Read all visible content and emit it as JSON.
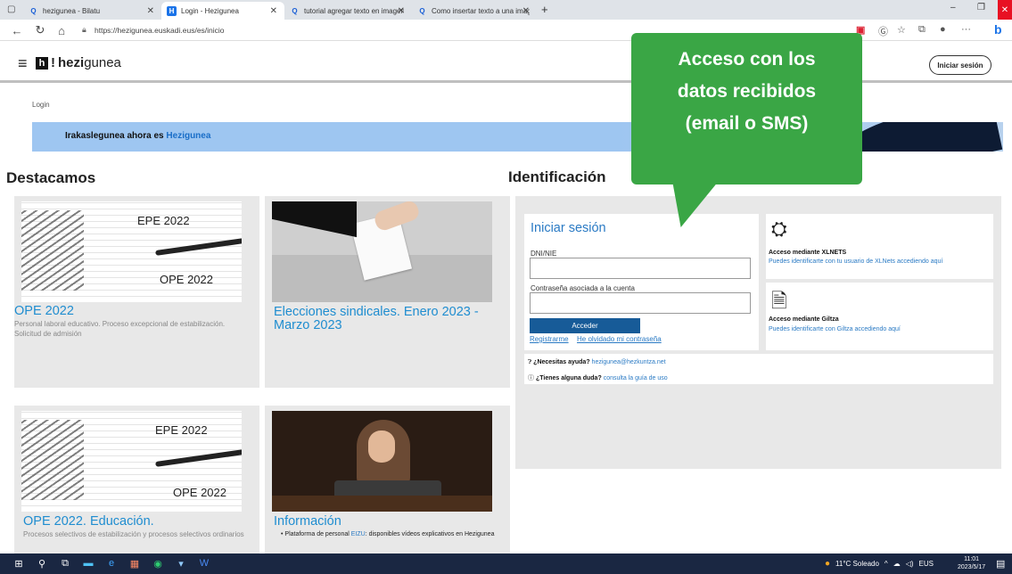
{
  "browser": {
    "tabs": [
      {
        "title": "hezigunea - Bilatu",
        "active": false
      },
      {
        "title": "Login - Hezigunea",
        "active": true
      },
      {
        "title": "tutorial agregar texto en imagen",
        "active": false
      },
      {
        "title": "Como insertar texto a una image",
        "active": false
      }
    ],
    "url": "https://hezigunea.euskadi.eus/es/inicio"
  },
  "site": {
    "logo_prefix": "hezi",
    "logo_suffix": "gunea",
    "login_button": "Iniciar sesión",
    "breadcrumb": "Login",
    "banner_text": "Irakaslegunea ahora es",
    "banner_highlight": "Hezigunea"
  },
  "destacamos": {
    "heading": "Destacamos",
    "cards": [
      {
        "title": "OPE 2022",
        "desc": "Personal laboral educativo. Proceso excepcional de estabilización. Solicitud de admisión",
        "img_text1": "EPE 2022",
        "img_text2": "OPE 2022"
      },
      {
        "title": "Elecciones sindicales. Enero 2023 - Marzo 2023",
        "desc": ""
      },
      {
        "title": "OPE 2022. Educación.",
        "desc": "Procesos selectivos de estabilización y procesos selectivos ordinarios",
        "img_text1": "EPE 2022",
        "img_text2": "OPE 2022"
      },
      {
        "title": "Información",
        "desc_prefix": "Plataforma de personal",
        "desc_link": "EIZU",
        "desc_suffix": ": disponibles vídeos explicativos en Hezigunea"
      }
    ]
  },
  "identificacion": {
    "heading": "Identificación",
    "login_title": "Iniciar sesión",
    "dni_label": "DNI/NIE",
    "password_label": "Contraseña asociada a la cuenta",
    "submit": "Acceder",
    "register_link": "Registrarme",
    "forgot_link": "He olvidado mi contraseña",
    "xlnets_title": "Acceso mediante XLNETS",
    "xlnets_link": "Puedes identificarte con tu usuario de XLNets accediendo aquí",
    "giltza_title": "Acceso mediante Giltza",
    "giltza_link": "Puedes identificarte con Giltza accediendo aquí",
    "help_label": "¿Necesitas ayuda?",
    "help_email": "hezigunea@hezkuntza.net",
    "doubt_label": "¿Tienes alguna duda?",
    "doubt_link": "consulta la guía de uso"
  },
  "callout": {
    "line1": "Acceso con los",
    "line2": "datos recibidos",
    "line3": "(email o SMS)",
    "color": "#3aa645"
  },
  "taskbar": {
    "weather": "11°C Soleado",
    "lang": "EUS",
    "time": "11:01",
    "date": "2023/5/17"
  }
}
